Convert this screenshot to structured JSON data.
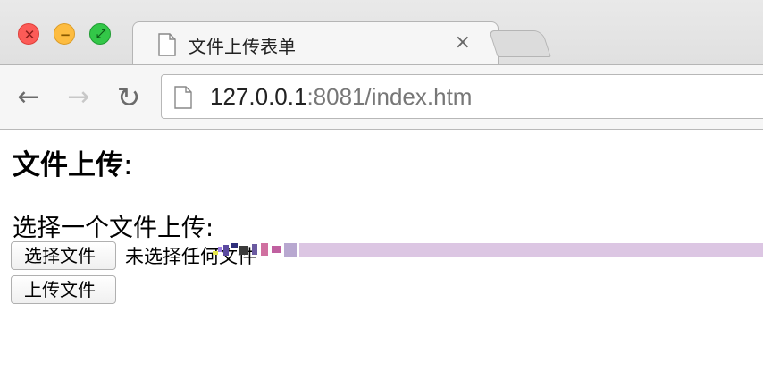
{
  "window": {
    "traffic_lights": {
      "close_glyph": "✕",
      "minimize_glyph": "−",
      "maximize_glyph": "⤢"
    }
  },
  "tab": {
    "title": "文件上传表单",
    "close_glyph": "×"
  },
  "toolbar": {
    "back_glyph": "←",
    "forward_glyph": "→",
    "reload_glyph": "↻",
    "url_host": "127.0.0.1",
    "url_rest": ":8081/index.htm"
  },
  "page": {
    "heading": "文件上传",
    "heading_colon": ":",
    "prompt": "选择一个文件上传:",
    "choose_button": "选择文件",
    "no_file_text": "未选择任何文件",
    "submit_button": "上传文件"
  },
  "colors": {
    "close": "#fc5b57",
    "minimize": "#fdbc40",
    "maximize": "#33c748",
    "glitch_bar": "#dcc6e3"
  },
  "icons": [
    "page-icon",
    "back-arrow-icon",
    "forward-arrow-icon",
    "reload-icon",
    "close-icon"
  ]
}
